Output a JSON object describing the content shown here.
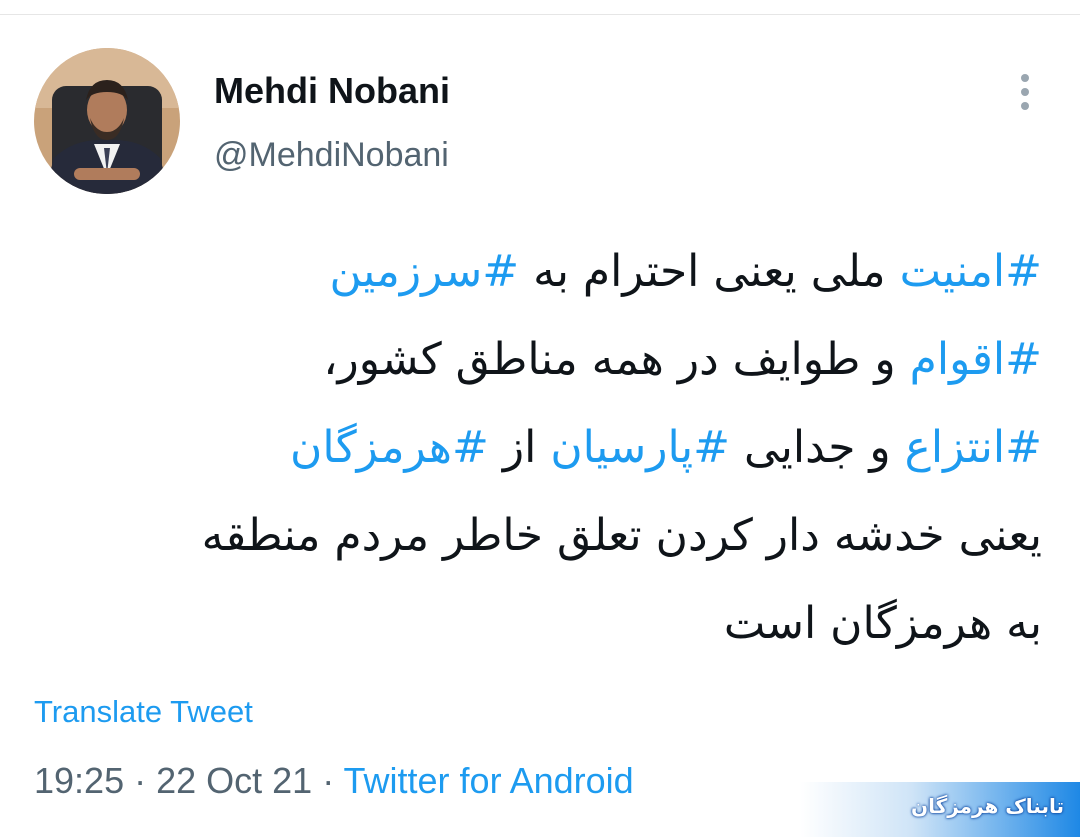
{
  "user": {
    "display_name": "Mehdi Nobani",
    "handle": "@MehdiNobani"
  },
  "tweet": {
    "lines": [
      [
        {
          "text": "#امنیت",
          "hashtag": true
        },
        {
          "text": " ملی یعنی احترام به ",
          "hashtag": false
        },
        {
          "text": "#سرزمین",
          "hashtag": true
        }
      ],
      [
        {
          "text": "#اقوام",
          "hashtag": true
        },
        {
          "text": " و طوایف در همه مناطق کشور،",
          "hashtag": false
        }
      ],
      [
        {
          "text": "#انتزاع",
          "hashtag": true
        },
        {
          "text": " و جدایی ",
          "hashtag": false
        },
        {
          "text": "#پارسیان",
          "hashtag": true
        },
        {
          "text": " از ",
          "hashtag": false
        },
        {
          "text": "#هرمزگان",
          "hashtag": true
        }
      ],
      [
        {
          "text": "یعنی خدشه دار کردن تعلق خاطر مردم منطقه",
          "hashtag": false
        }
      ],
      [
        {
          "text": "به هرمزگان است",
          "hashtag": false
        }
      ]
    ],
    "translate_label": "Translate Tweet",
    "time": "19:25",
    "separator": " · ",
    "date": "22 Oct 21",
    "source": "Twitter for Android"
  },
  "icons": {
    "more": "more-vertical-icon"
  },
  "watermark": {
    "text": "تابناک هرمزگان"
  },
  "colors": {
    "link": "#1d9bf0",
    "secondary_text": "#536471",
    "primary_text": "#0f1419"
  }
}
